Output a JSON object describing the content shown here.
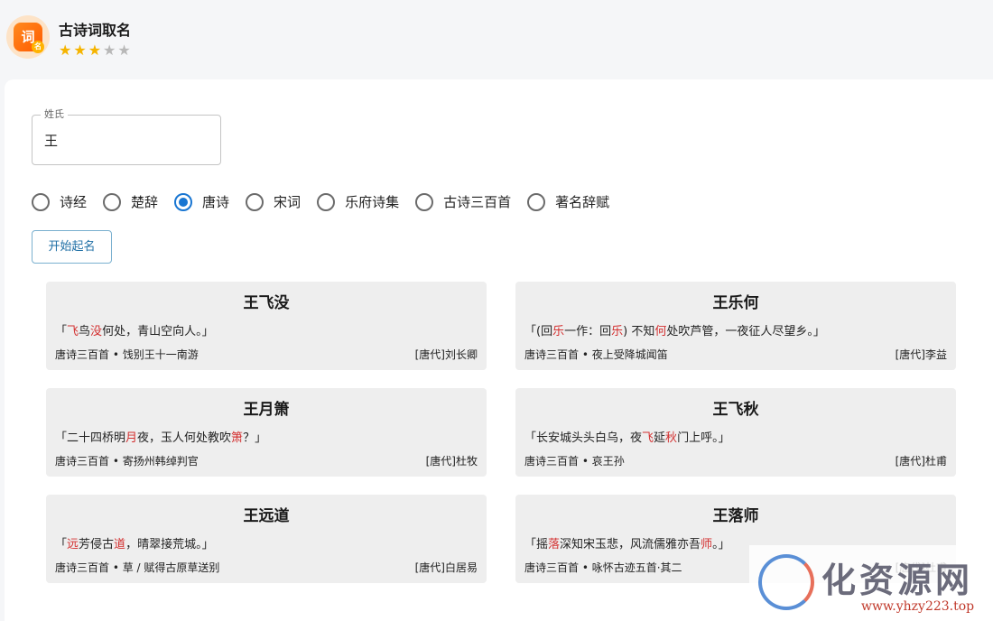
{
  "app": {
    "title": "古诗词取名",
    "icon_text": "词",
    "icon_badge": "名",
    "rating": 3,
    "rating_max": 5
  },
  "form": {
    "surname_label": "姓氏",
    "surname_value": "王",
    "collections": [
      "诗经",
      "楚辞",
      "唐诗",
      "宋词",
      "乐府诗集",
      "古诗三百首",
      "著名辞赋"
    ],
    "selected_collection": "唐诗",
    "start_button": "开始起名"
  },
  "results": [
    {
      "name": "王飞没",
      "verse": [
        {
          "t": "「",
          "h": false
        },
        {
          "t": "飞",
          "h": true
        },
        {
          "t": "鸟",
          "h": false
        },
        {
          "t": "没",
          "h": true
        },
        {
          "t": "何处，青山空向人。」",
          "h": false
        }
      ],
      "source": "唐诗三百首 • 饯别王十一南游",
      "author": "[唐代]刘长卿"
    },
    {
      "name": "王乐何",
      "verse": [
        {
          "t": "「(回",
          "h": false
        },
        {
          "t": "乐",
          "h": true
        },
        {
          "t": "一作：回",
          "h": false
        },
        {
          "t": "乐",
          "h": true
        },
        {
          "t": ") 不知",
          "h": false
        },
        {
          "t": "何",
          "h": true
        },
        {
          "t": "处吹芦管，一夜征人尽望乡。」",
          "h": false
        }
      ],
      "source": "唐诗三百首 • 夜上受降城闻笛",
      "author": "[唐代]李益"
    },
    {
      "name": "王月箫",
      "verse": [
        {
          "t": "「二十四桥明",
          "h": false
        },
        {
          "t": "月",
          "h": true
        },
        {
          "t": "夜，玉人何处教吹",
          "h": false
        },
        {
          "t": "箫",
          "h": true
        },
        {
          "t": "？」",
          "h": false
        }
      ],
      "source": "唐诗三百首 • 寄扬州韩绰判官",
      "author": "[唐代]杜牧"
    },
    {
      "name": "王飞秋",
      "verse": [
        {
          "t": "「长安城头头白乌，夜",
          "h": false
        },
        {
          "t": "飞",
          "h": true
        },
        {
          "t": "延",
          "h": false
        },
        {
          "t": "秋",
          "h": true
        },
        {
          "t": "门上呼。」",
          "h": false
        }
      ],
      "source": "唐诗三百首 • 哀王孙",
      "author": "[唐代]杜甫"
    },
    {
      "name": "王远道",
      "verse": [
        {
          "t": "「",
          "h": false
        },
        {
          "t": "远",
          "h": true
        },
        {
          "t": "芳侵古",
          "h": false
        },
        {
          "t": "道",
          "h": true
        },
        {
          "t": "，晴翠接荒城。」",
          "h": false
        }
      ],
      "source": "唐诗三百首 • 草 / 赋得古原草送别",
      "author": "[唐代]白居易"
    },
    {
      "name": "王落师",
      "verse": [
        {
          "t": "「摇",
          "h": false
        },
        {
          "t": "落",
          "h": true
        },
        {
          "t": "深知宋玉悲，风流儒雅亦吾",
          "h": false
        },
        {
          "t": "师",
          "h": true
        },
        {
          "t": "。」",
          "h": false
        }
      ],
      "source": "唐诗三百首 • 咏怀古迹五首·其二",
      "author": "[唐代]杜甫"
    }
  ],
  "watermark": {
    "text": "化资源网",
    "url": "www.yhzy223.top"
  },
  "colors": {
    "accent": "#1976d2",
    "highlight": "#d32f2f",
    "star_on": "#f5b400",
    "star_off": "#b8b8b8"
  }
}
